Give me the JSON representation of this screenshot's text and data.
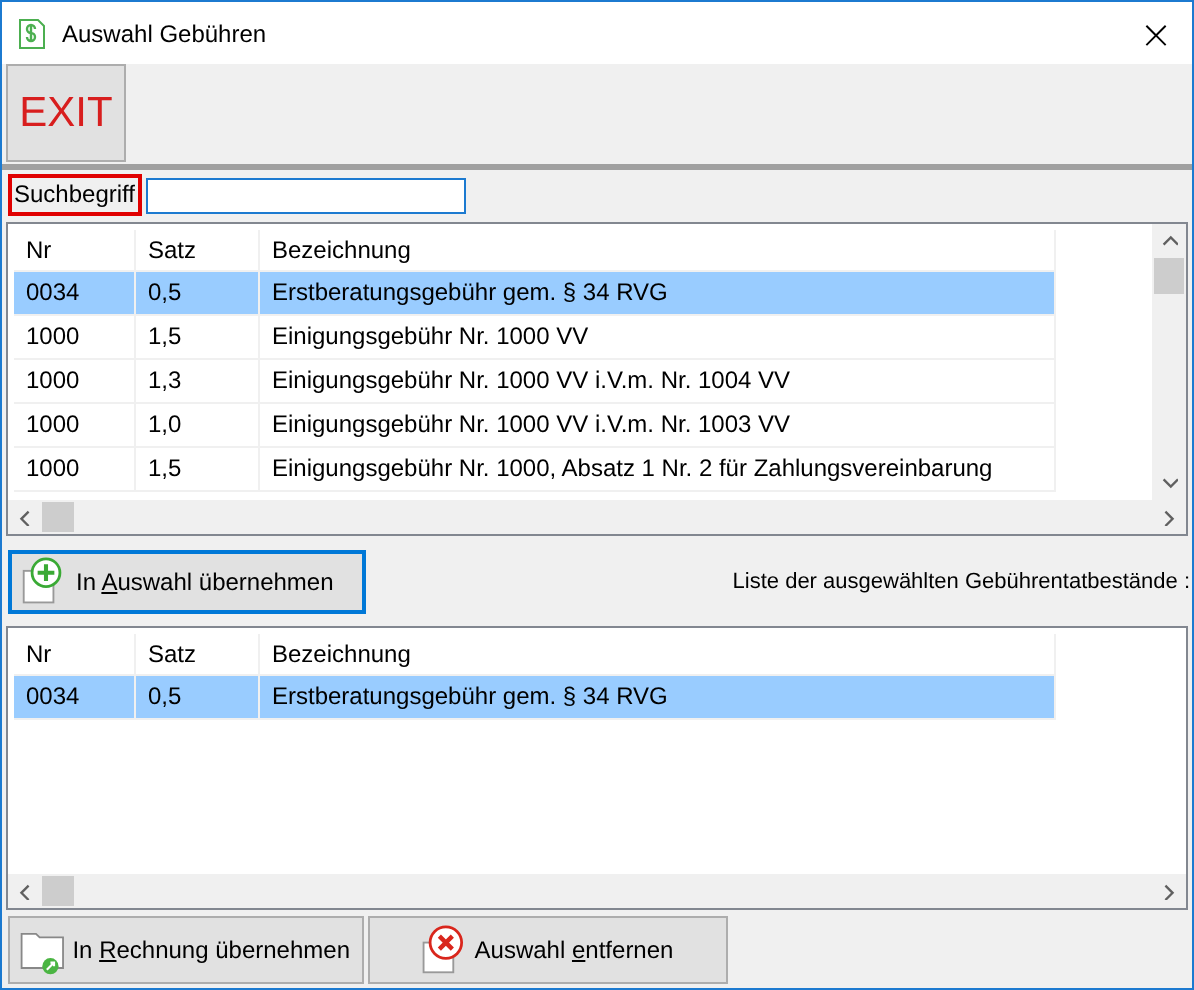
{
  "window": {
    "title": "Auswahl Gebühren",
    "close": "×"
  },
  "toolbar": {
    "exit_button": "EXIT"
  },
  "search": {
    "label": "Suchbegriff"
  },
  "fee_table": {
    "columns": [
      "Nr",
      "Satz",
      "Bezeichnung"
    ],
    "rows": [
      {
        "cells": [
          "0034",
          "0,5",
          "Erstberatungsgebühr gem. § 34 RVG"
        ],
        "selected": true
      },
      {
        "cells": [
          "1000",
          "1,5",
          "Einigungsgebühr Nr. 1000 VV"
        ],
        "selected": false
      },
      {
        "cells": [
          "1000",
          "1,3",
          "Einigungsgebühr Nr. 1000 VV i.V.m. Nr. 1004 VV"
        ],
        "selected": false
      },
      {
        "cells": [
          "1000",
          "1,0",
          "Einigungsgebühr Nr. 1000 VV i.V.m. Nr. 1003 VV"
        ],
        "selected": false
      },
      {
        "cells": [
          "1000",
          "1,5",
          "Einigungsgebühr Nr. 1000, Absatz 1 Nr. 2 für Zahlungsvereinbarung"
        ],
        "selected": false
      }
    ]
  },
  "add_button": {
    "label_parts": [
      "In ",
      "A",
      "uswahl übernehmen"
    ]
  },
  "selected_list_label": "Liste der ausgewählten Gebührentatbestände :",
  "selected_table": {
    "columns": [
      "Nr",
      "Satz",
      "Bezeichnung"
    ],
    "rows": [
      {
        "cells": [
          "0034",
          "0,5",
          "Erstberatungsgebühr gem. § 34 RVG"
        ],
        "selected": true
      }
    ]
  },
  "bottom_buttons": [
    {
      "label_parts": [
        "In ",
        "R",
        "echnung übernehmen"
      ]
    },
    {
      "label_parts": [
        "Auswahl ",
        "e",
        "ntfernen"
      ]
    }
  ]
}
